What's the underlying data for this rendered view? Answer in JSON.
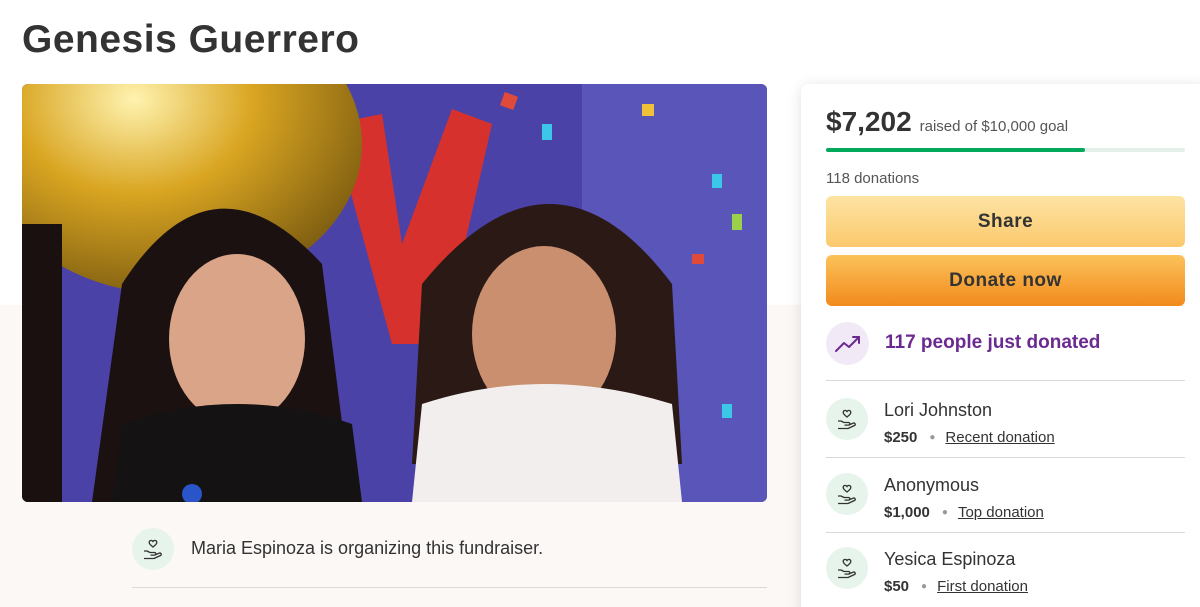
{
  "page": {
    "title": "Genesis Guerrero"
  },
  "organizer": {
    "text": "Maria Espinoza is organizing this fundraiser."
  },
  "campaign": {
    "raised": "$7,202",
    "goal_text": "raised of $10,000 goal",
    "progress_fraction": 0.7202,
    "donation_count": "118 donations",
    "share_label": "Share",
    "donate_label": "Donate now",
    "trending_text": "117 people just donated"
  },
  "donors": [
    {
      "name": "Lori Johnston",
      "amount": "$250",
      "type": "Recent donation"
    },
    {
      "name": "Anonymous",
      "amount": "$1,000",
      "type": "Top donation"
    },
    {
      "name": "Yesica Espinoza",
      "amount": "$50",
      "type": "First donation"
    }
  ],
  "colors": {
    "progress": "#02a95c",
    "trending": "#6b2a91",
    "donate_button": "#f28a1c",
    "share_button": "#fbc96d"
  },
  "icons": {
    "avatar": "heart-hand-icon",
    "trending": "trending-up-icon"
  }
}
